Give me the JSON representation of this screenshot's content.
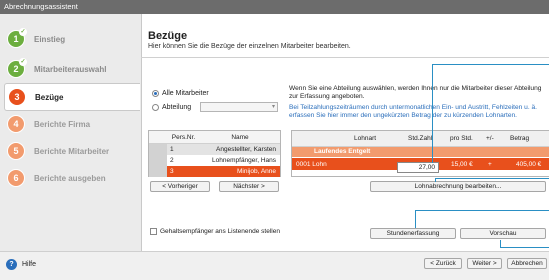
{
  "window": {
    "title": "Abrechnungsassistent"
  },
  "steps": [
    {
      "num": "1",
      "label": "Einstieg",
      "state": "done"
    },
    {
      "num": "2",
      "label": "Mitarbeiterauswahl",
      "state": "done"
    },
    {
      "num": "3",
      "label": "Bezüge",
      "state": "active"
    },
    {
      "num": "4",
      "label": "Berichte Firma",
      "state": "pending"
    },
    {
      "num": "5",
      "label": "Berichte Mitarbeiter",
      "state": "pending"
    },
    {
      "num": "6",
      "label": "Berichte ausgeben",
      "state": "pending"
    }
  ],
  "header": {
    "title": "Bezüge",
    "subtitle": "Hier können Sie die Bezüge der einzelnen Mitarbeiter bearbeiten."
  },
  "filter": {
    "option_all": "Alle Mitarbeiter",
    "option_dept": "Abteilung",
    "selected": "all"
  },
  "info": {
    "text1": "Wenn Sie eine Abteilung auswählen, werden Ihnen nur die Mitarbeiter dieser Abteilung zur Erfassung angeboten.",
    "text2": "Bei Teilzahlungszeiträumen durch unterm­onatlichen Ein- und Austritt, Fehlzeiten u. ä. erfassen Sie hier immer den ungekürzten Betrag der zu kürzenden Lohnarten."
  },
  "employees": {
    "columns": [
      "Pers.Nr.",
      "Name"
    ],
    "rows": [
      {
        "nr": "1",
        "name": "Angestellter, Karsten",
        "state": "normal"
      },
      {
        "nr": "2",
        "name": "Lohnempfänger, Hans",
        "state": "normal"
      },
      {
        "nr": "3",
        "name": "Minijob, Anne",
        "state": "selected"
      }
    ]
  },
  "wages": {
    "columns": [
      "Lohnart",
      "Std.Zahl",
      "pro Std.",
      "+/-",
      "Betrag"
    ],
    "section": "Laufendes Entgelt",
    "rows": [
      {
        "lohnart": "0001 Lohn",
        "std": "27,00",
        "pro_std": "15,00 €",
        "sign": "+",
        "betrag": "405,00 €"
      }
    ]
  },
  "buttons": {
    "prev": "< Vorheriger",
    "next": "Nächster >",
    "edit_wage": "Lohnabrechnung bearbeiten...",
    "hours": "Stundenerfassung",
    "preview": "Vorschau",
    "back": "< Zurück",
    "forward": "Weiter >",
    "cancel": "Abbrechen"
  },
  "checkbox": {
    "label": "Gehaltsempfänger ans Listenende stellen",
    "checked": false
  },
  "footer": {
    "help": "Hilfe"
  },
  "colors": {
    "accent": "#e8501c",
    "accent_light": "#f29b6e",
    "done": "#6cae3f",
    "link": "#2a6ebb",
    "callout": "#2a8fc4"
  }
}
